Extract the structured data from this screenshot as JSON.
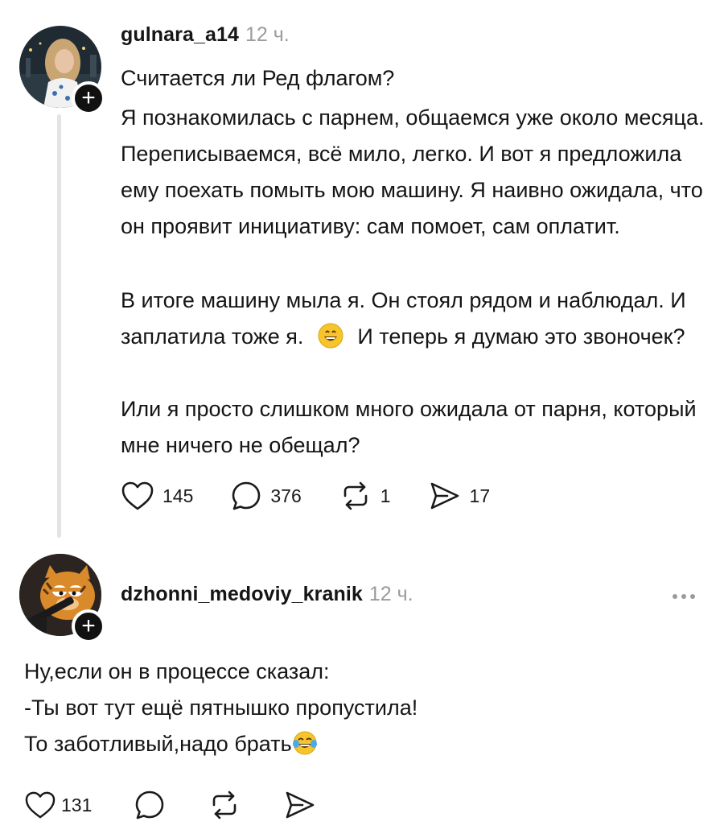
{
  "post": {
    "username": "gulnara_a14",
    "time": "12 ч.",
    "title": "Считается ли Ред флагом?",
    "paragraphs": [
      "Я познакомилась с парнем, общаемся уже около месяца. Переписываемся, всё мило, легко. И вот я предложила ему поехать помыть мою машину. Я наивно ожидала, что он проявит инициативу: сам помоет, сам оплатит.",
      "В итоге машину мыла я. Он стоял рядом и наблюдал. И заплатила тоже я.",
      "И теперь я думаю это звоночек?",
      "Или я просто слишком много ожидала от парня, который мне ничего не обещал?"
    ],
    "likes": "145",
    "comments": "376",
    "reposts": "1",
    "shares": "17",
    "avatar_icon": "user-photo",
    "follow_icon": "plus-icon"
  },
  "reply": {
    "username": "dzhonni_medoviy_kranik",
    "time": "12 ч.",
    "lines": [
      "Ну,если он в процессе сказал:",
      "-Ты вот тут ещё пятнышко пропустила!",
      "То заботливый,надо брать"
    ],
    "likes": "131",
    "avatar_icon": "cat-avatar",
    "follow_icon": "plus-icon"
  },
  "colors": {
    "text": "#151515",
    "muted": "#9b9b9b",
    "thread_line": "#e4e4e4",
    "emoji_yellow": "#f7c52b"
  }
}
